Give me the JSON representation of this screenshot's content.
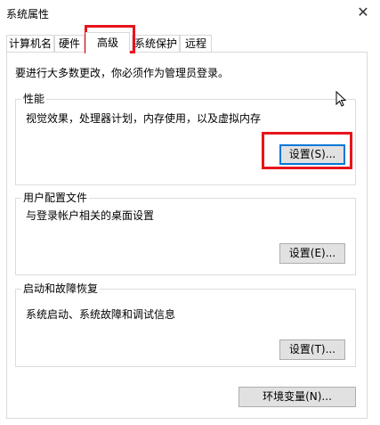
{
  "window": {
    "title": "系统属性"
  },
  "tabs": [
    {
      "label": "计算机名",
      "active": false
    },
    {
      "label": "硬件",
      "active": false
    },
    {
      "label": "高级",
      "active": true
    },
    {
      "label": "系统保护",
      "active": false
    },
    {
      "label": "远程",
      "active": false
    }
  ],
  "note": "要进行大多数更改，你必须作为管理员登录。",
  "performance": {
    "title": "性能",
    "desc": "视觉效果，处理器计划，内存使用，以及虚拟内存",
    "button": "设置(S)..."
  },
  "profiles": {
    "title": "用户配置文件",
    "desc": "与登录帐户相关的桌面设置",
    "button": "设置(E)..."
  },
  "startup": {
    "title": "启动和故障恢复",
    "desc": "系统启动、系统故障和调试信息",
    "button": "设置(T)..."
  },
  "env_button": "环境变量(N)...",
  "colors": {
    "highlight": "#e8141c",
    "button_bg": "#e1e1e1",
    "focus": "#0078d7"
  }
}
